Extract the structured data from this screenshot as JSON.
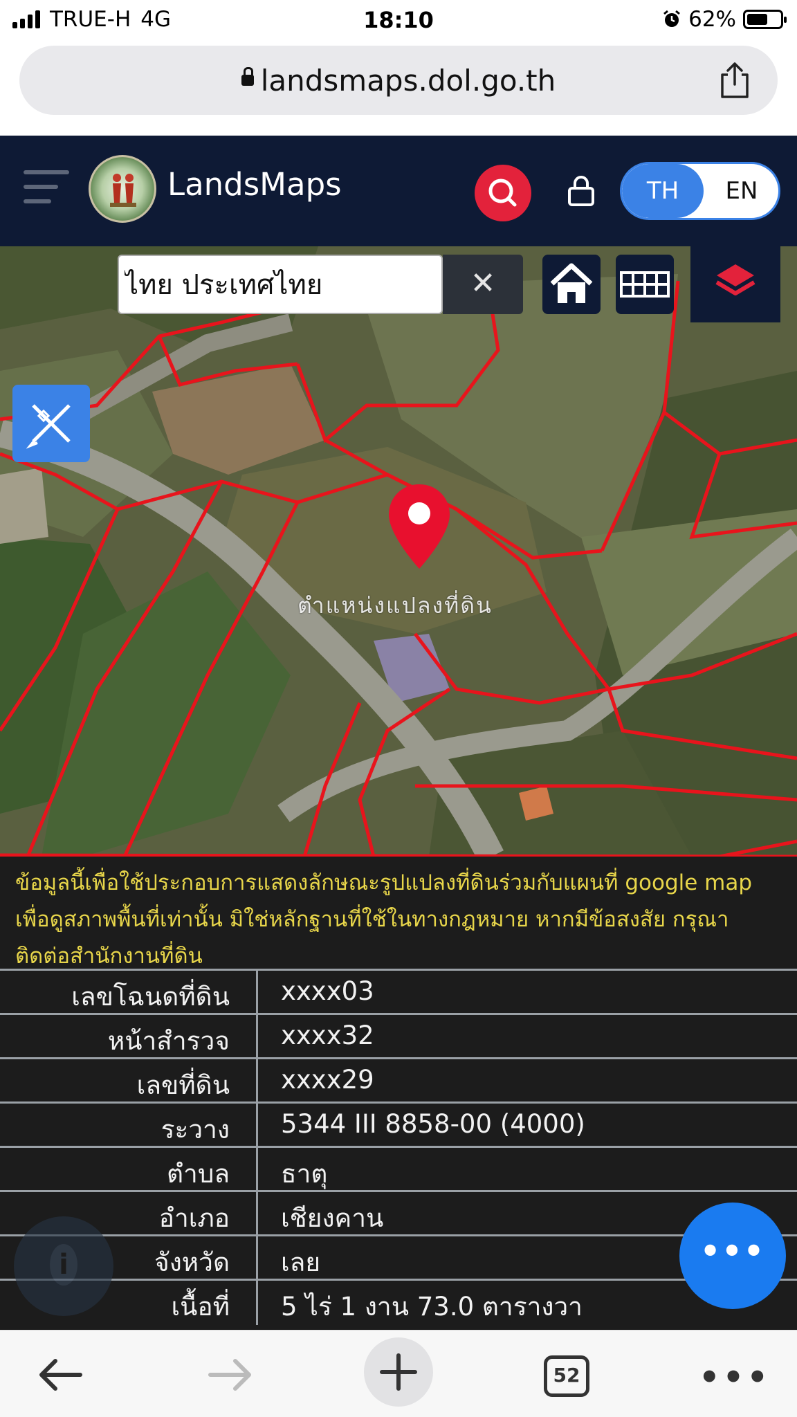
{
  "status_bar": {
    "carrier": "TRUE-H",
    "network": "4G",
    "time": "18:10",
    "battery": "62%",
    "battery_level": 0.62
  },
  "browser": {
    "url": "landsmaps.dol.go.th"
  },
  "header": {
    "brand": "LandsMaps",
    "lang_th": "TH",
    "lang_en": "EN"
  },
  "map": {
    "search_value": "ไทย ประเทศไทย",
    "clear_glyph": "✕",
    "parcel_label": "ตำแหน่งแปลงที่ดิน"
  },
  "info": {
    "disclaimer": "ข้อมูลนี้เพื่อใช้ประกอบการแสดงลักษณะรูปแปลงที่ดินร่วมกับแผนที่ google map เพื่อดูสภาพพื้นที่เท่านั้น มิใช่หลักฐานที่ใช้ในทางกฎหมาย หากมีข้อสงสัย กรุณาติดต่อสำนักงานที่ดิน",
    "rows": [
      {
        "label": "เลขโฉนดที่ดิน",
        "value": "xxxx03"
      },
      {
        "label": "หน้าสำรวจ",
        "value": "xxxx32"
      },
      {
        "label": "เลขที่ดิน",
        "value": "xxxx29"
      },
      {
        "label": "ระวาง",
        "value": "5344 III 8858-00 (4000)"
      },
      {
        "label": "ตำบล",
        "value": "ธาตุ"
      },
      {
        "label": "อำเภอ",
        "value": "เชียงคาน"
      },
      {
        "label": "จังหวัด",
        "value": "เลย"
      },
      {
        "label": "เนื้อที่",
        "value": "5 ไร่ 1 งาน 73.0 ตารางวา"
      }
    ],
    "info_glyph": "i",
    "fab_glyph": "•••"
  },
  "toolbar": {
    "tab_count": "52",
    "more_glyph": "•••"
  },
  "colors": {
    "header_bg": "#0e1a35",
    "accent_blue": "#3b82e6",
    "search_red": "#e3223b",
    "parcel_line": "#e8141c",
    "disclaimer_yellow": "#e8d64a"
  }
}
